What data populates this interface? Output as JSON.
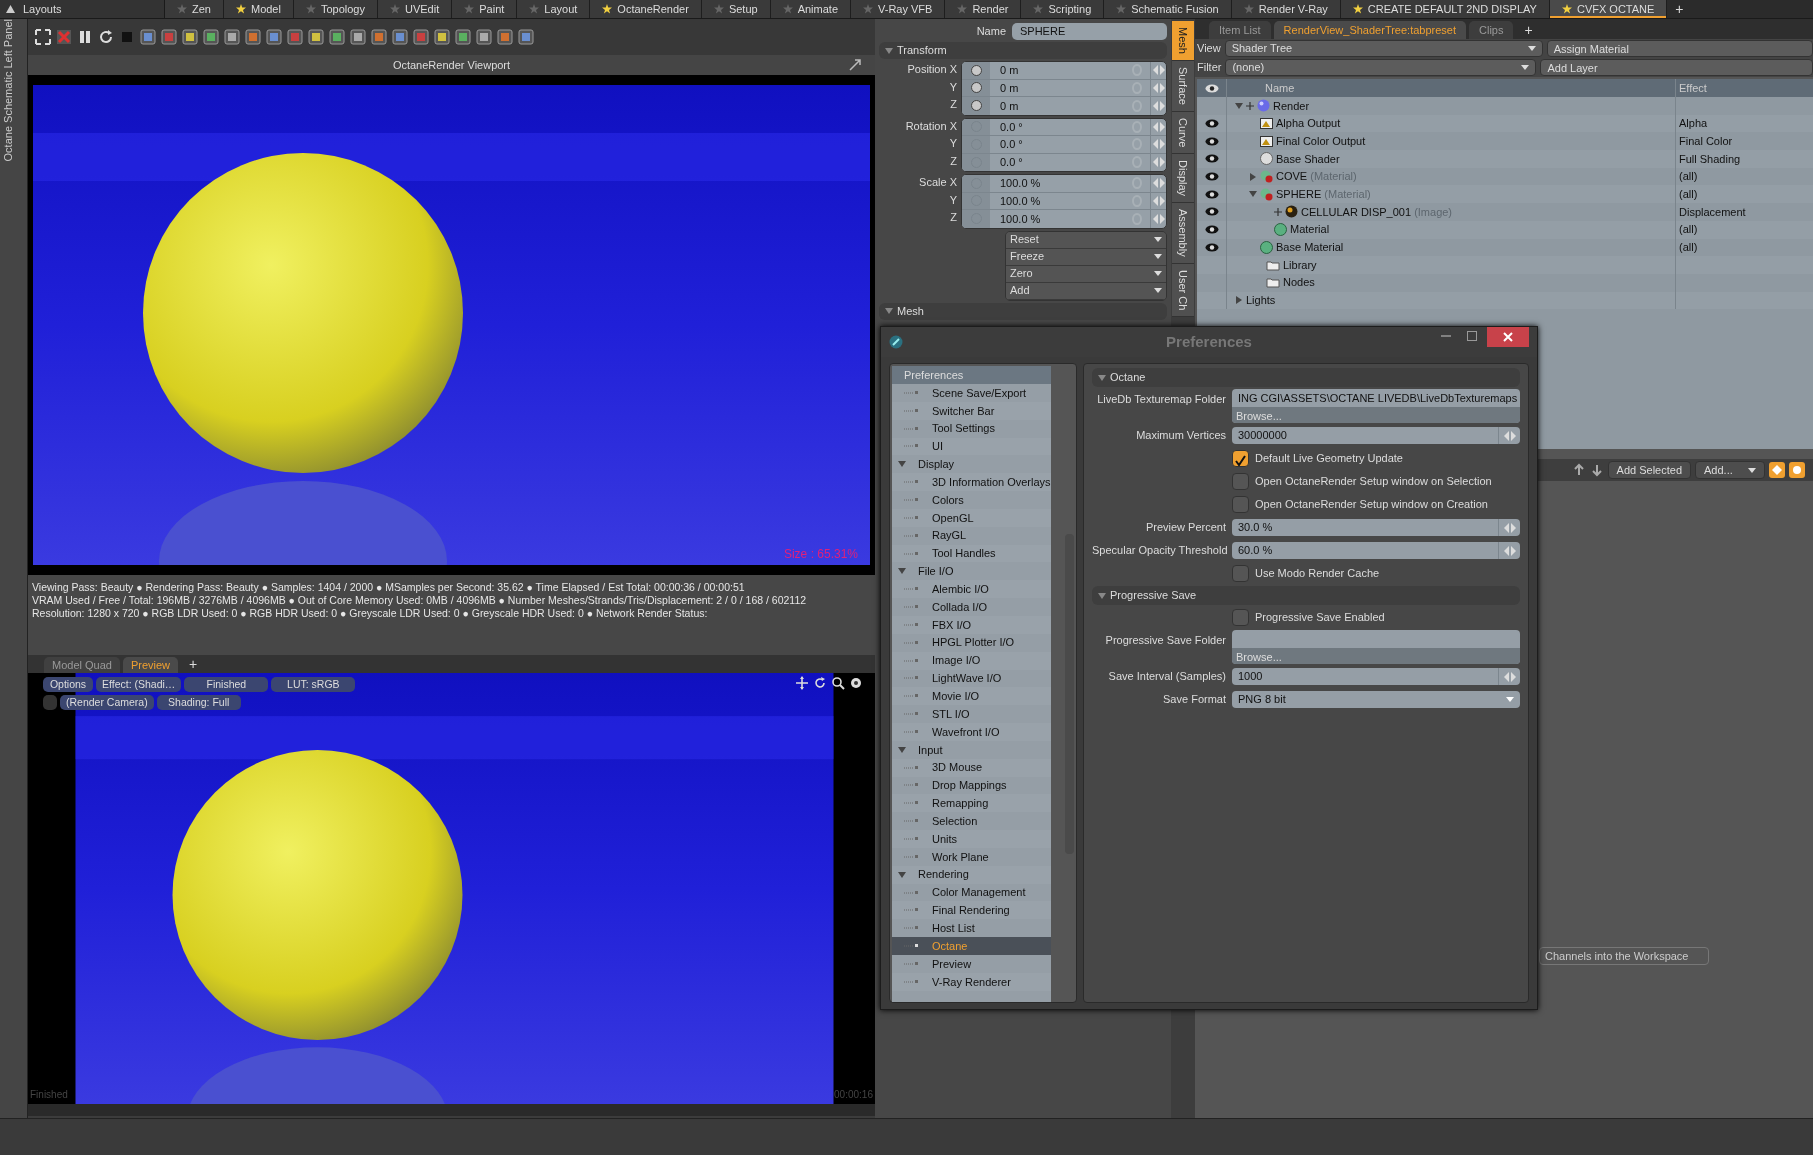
{
  "layout_menu": {
    "label": "Layouts"
  },
  "layout_tabs": [
    {
      "label": "Zen",
      "favorite": false,
      "selected": false
    },
    {
      "label": "Model",
      "favorite": true,
      "selected": false
    },
    {
      "label": "Topology",
      "favorite": false,
      "selected": false
    },
    {
      "label": "UVEdit",
      "favorite": false,
      "selected": false
    },
    {
      "label": "Paint",
      "favorite": false,
      "selected": false
    },
    {
      "label": "Layout",
      "favorite": false,
      "selected": false
    },
    {
      "label": "OctaneRender",
      "favorite": true,
      "selected": false
    },
    {
      "label": "Setup",
      "favorite": false,
      "selected": false
    },
    {
      "label": "Animate",
      "favorite": false,
      "selected": false
    },
    {
      "label": "V-Ray VFB",
      "favorite": false,
      "selected": false
    },
    {
      "label": "Render",
      "favorite": false,
      "selected": false
    },
    {
      "label": "Scripting",
      "favorite": false,
      "selected": false
    },
    {
      "label": "Schematic Fusion",
      "favorite": false,
      "selected": false
    },
    {
      "label": "Render V-Ray",
      "favorite": false,
      "selected": false
    },
    {
      "label": "CREATE DEFAULT 2ND DISPLAY",
      "favorite": true,
      "selected": false
    },
    {
      "label": "CVFX OCTANE",
      "favorite": true,
      "selected": true
    }
  ],
  "add_tab": "+",
  "left_panel": {
    "label": "Octane Schematic Left Panel"
  },
  "viewport": {
    "title": "OctaneRender Viewport",
    "size_label": "Size : 65.31%",
    "stats": [
      "Viewing Pass: Beauty ● Rendering Pass: Beauty ● Samples: 1404  / 2000 ● MSamples per Second: 35.62 ● Time Elapsed / Est Total: 00:00:36 / 00:00:51",
      "VRAM Used / Free / Total: 196MB / 3276MB / 4096MB ● Out of Core Memory Used: 0MB / 4096MB ● Number Meshes/Strands/Tris/Displacement: 2 / 0 / 168 / 602112",
      "Resolution: 1280 x 720 ● RGB LDR Used: 0 ● RGB HDR Used: 0 ● Greyscale LDR Used: 0 ● Greyscale HDR Used: 0 ● Network Render Status:"
    ]
  },
  "preview_tabs": [
    {
      "label": "Model Quad",
      "selected": false
    },
    {
      "label": "Preview",
      "selected": true
    }
  ],
  "preview_add_tab": "+",
  "preview": {
    "button_rows": [
      [
        "Options",
        "Effect: (Shadi…",
        "Finished",
        "LUT: sRGB"
      ],
      [
        "",
        "(Render Camera)",
        "Shading: Full"
      ]
    ],
    "status": "Finished",
    "time": "00:00:16"
  },
  "properties": {
    "name_label": "Name",
    "name_value": "SPHERE",
    "section": "Transform",
    "groups": [
      {
        "rows": [
          {
            "label": "Position X",
            "value": "0 m",
            "dot_on": true
          },
          {
            "label": "Y",
            "value": "0 m",
            "dot_on": true
          },
          {
            "label": "Z",
            "value": "0 m",
            "dot_on": true
          }
        ]
      },
      {
        "rows": [
          {
            "label": "Rotation X",
            "value": "0.0 °",
            "dot_on": false
          },
          {
            "label": "Y",
            "value": "0.0 °",
            "dot_on": false
          },
          {
            "label": "Z",
            "value": "0.0 °",
            "dot_on": false
          }
        ]
      },
      {
        "rows": [
          {
            "label": "Scale X",
            "value": "100.0 %",
            "dot_on": false
          },
          {
            "label": "Y",
            "value": "100.0 %",
            "dot_on": false
          },
          {
            "label": "Z",
            "value": "100.0 %",
            "dot_on": false
          }
        ]
      }
    ],
    "actions": [
      "Reset",
      "Freeze",
      "Zero",
      "Add"
    ],
    "section2": "Mesh"
  },
  "side_tabs": [
    {
      "label": "Mesh",
      "selected": true
    },
    {
      "label": "Surface",
      "selected": false
    },
    {
      "label": "Curve",
      "selected": false
    },
    {
      "label": "Display",
      "selected": false
    },
    {
      "label": "Assembly",
      "selected": false
    },
    {
      "label": "User Ch",
      "selected": false
    }
  ],
  "shader_panel": {
    "tabs": [
      {
        "label": "Item List",
        "selected": false
      },
      {
        "label": "RenderView_ShaderTree:tabpreset",
        "selected": true
      },
      {
        "label": "Clips",
        "selected": false
      }
    ],
    "add_tab": "+",
    "view_label": "View",
    "view_value": "Shader Tree",
    "assign": "Assign Material",
    "filter_label": "Filter",
    "filter_value": "(none)",
    "add_layer": "Add Layer",
    "columns": [
      "Name",
      "Effect"
    ],
    "tree": [
      {
        "name": "Render",
        "kind": "render",
        "visible": false,
        "expanded": true,
        "plus": true,
        "children": [
          {
            "name": "Alpha Output",
            "kind": "output",
            "visible": true,
            "effect": "Alpha"
          },
          {
            "name": "Final Color Output",
            "kind": "output",
            "visible": true,
            "effect": "Final Color"
          },
          {
            "name": "Base Shader",
            "kind": "shader",
            "visible": true,
            "effect": "Full Shading"
          },
          {
            "name": "COVE",
            "tag": "(Material)",
            "kind": "material",
            "visible": true,
            "expanded": false,
            "effect": "(all)"
          },
          {
            "name": "SPHERE",
            "tag": "(Material)",
            "kind": "material",
            "visible": true,
            "expanded": true,
            "effect": "(all)",
            "children": [
              {
                "name": "CELLULAR DISP_001",
                "tag": "(Image)",
                "kind": "image",
                "visible": true,
                "plus": true,
                "effect": "Displacement"
              },
              {
                "name": "Material",
                "kind": "mask",
                "visible": true,
                "effect": "(all)"
              }
            ]
          },
          {
            "name": "Base Material",
            "kind": "mask",
            "visible": true,
            "effect": "(all)"
          }
        ]
      },
      {
        "name": "Library",
        "kind": "folder",
        "visible": false
      },
      {
        "name": "Nodes",
        "kind": "folder",
        "visible": false
      },
      {
        "name": "Lights",
        "kind": "group",
        "visible": false,
        "expanded": false
      }
    ]
  },
  "item_toolbar": {
    "add_selected": "Add Selected",
    "add_menu": "Add..."
  },
  "channels_hint": "Channels into the Workspace",
  "preferences": {
    "title": "Preferences",
    "nav_header": "Preferences",
    "nav": [
      {
        "label": "Scene Save/Export",
        "selected": false
      },
      {
        "label": "Switcher Bar",
        "selected": false
      },
      {
        "label": "Tool Settings",
        "selected": false
      },
      {
        "label": "UI",
        "selected": false
      },
      {
        "label": "Display",
        "selected": false,
        "expanded": true,
        "children": [
          {
            "label": "3D Information Overlays",
            "selected": false
          },
          {
            "label": "Colors",
            "selected": false
          },
          {
            "label": "OpenGL",
            "selected": false
          },
          {
            "label": "RayGL",
            "selected": false
          },
          {
            "label": "Tool Handles",
            "selected": false
          }
        ]
      },
      {
        "label": "File I/O",
        "selected": false,
        "expanded": true,
        "children": [
          {
            "label": "Alembic I/O",
            "selected": false
          },
          {
            "label": "Collada I/O",
            "selected": false
          },
          {
            "label": "FBX I/O",
            "selected": false
          },
          {
            "label": "HPGL Plotter I/O",
            "selected": false
          },
          {
            "label": "Image I/O",
            "selected": false
          },
          {
            "label": "LightWave I/O",
            "selected": false
          },
          {
            "label": "Movie I/O",
            "selected": false
          },
          {
            "label": "STL I/O",
            "selected": false
          },
          {
            "label": "Wavefront I/O",
            "selected": false
          }
        ]
      },
      {
        "label": "Input",
        "selected": false,
        "expanded": true,
        "children": [
          {
            "label": "3D Mouse",
            "selected": false
          },
          {
            "label": "Drop Mappings",
            "selected": false
          },
          {
            "label": "Remapping",
            "selected": false
          },
          {
            "label": "Selection",
            "selected": false
          },
          {
            "label": "Units",
            "selected": false
          },
          {
            "label": "Work Plane",
            "selected": false
          }
        ]
      },
      {
        "label": "Rendering",
        "selected": false,
        "expanded": true,
        "children": [
          {
            "label": "Color Management",
            "selected": false
          },
          {
            "label": "Final Rendering",
            "selected": false
          },
          {
            "label": "Host List",
            "selected": false
          },
          {
            "label": "Octane",
            "selected": true
          },
          {
            "label": "Preview",
            "selected": false
          },
          {
            "label": "V-Ray Renderer",
            "selected": false
          }
        ]
      }
    ],
    "sections": [
      {
        "title": "Octane",
        "fields": [
          {
            "kind": "path",
            "label": "LiveDb Texturemap Folder",
            "value": "ING CGI\\ASSETS\\OCTANE LIVEDB\\LiveDbTexturemaps",
            "browse": "Browse..."
          },
          {
            "kind": "number",
            "label": "Maximum Vertices",
            "value": "30000000"
          },
          {
            "kind": "checkbox",
            "label": "Default Live Geometry Update",
            "checked": true
          },
          {
            "kind": "checkbox",
            "label": "Open OctaneRender Setup window on Selection",
            "checked": false
          },
          {
            "kind": "checkbox",
            "label": "Open OctaneRender Setup window on Creation",
            "checked": false
          },
          {
            "kind": "number",
            "label": "Preview Percent",
            "value": "30.0 %"
          },
          {
            "kind": "number",
            "label": "Specular Opacity Threshold",
            "value": "60.0 %"
          },
          {
            "kind": "checkbox",
            "label": "Use Modo Render Cache",
            "checked": false
          }
        ]
      },
      {
        "title": "Progressive Save",
        "fields": [
          {
            "kind": "checkbox",
            "label": "Progressive Save Enabled",
            "checked": false
          },
          {
            "kind": "path",
            "label": "Progressive Save Folder",
            "browse": "Browse..."
          },
          {
            "kind": "number",
            "label": "Save Interval (Samples)",
            "value": "1000"
          },
          {
            "kind": "dropdown",
            "label": "Save Format",
            "value": "PNG 8 bit"
          }
        ]
      }
    ]
  }
}
